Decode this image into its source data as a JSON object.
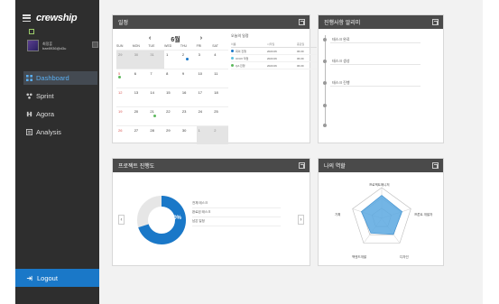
{
  "app": {
    "logo": "crewship"
  },
  "profile": {
    "name": "최정훈",
    "email": "bae8936@d3u"
  },
  "nav": [
    {
      "label": "Dashboard",
      "icon": "grid-icon",
      "active": true
    },
    {
      "label": "Sprint",
      "icon": "sprint-icon",
      "active": false
    },
    {
      "label": "Agora",
      "icon": "agora-icon",
      "active": false
    },
    {
      "label": "Analysis",
      "icon": "analysis-icon",
      "active": false
    }
  ],
  "logout_label": "Logout",
  "calendar": {
    "title": "일정",
    "month_label": "6월",
    "prev": "‹",
    "next": "›",
    "dow": [
      "SUN",
      "MON",
      "TUE",
      "WED",
      "THU",
      "FRI",
      "SAT"
    ],
    "weeks": [
      [
        "29",
        "30",
        "31",
        "1",
        "2",
        "3",
        "4"
      ],
      [
        "5",
        "6",
        "7",
        "8",
        "9",
        "10",
        "11"
      ],
      [
        "12",
        "13",
        "14",
        "15",
        "16",
        "17",
        "18"
      ],
      [
        "19",
        "20",
        "21",
        "22",
        "23",
        "24",
        "25"
      ],
      [
        "26",
        "27",
        "28",
        "29",
        "30",
        "1",
        "2"
      ]
    ],
    "schedule_title": "오늘의 일정",
    "schedule_head": [
      "이름",
      "시작일",
      "종료일"
    ],
    "schedule_rows": [
      {
        "name": "회의 진행",
        "start": "2023.06",
        "end": "06.09",
        "color": "#1a78c8"
      },
      {
        "name": "UI/UX 작업",
        "start": "2023.06",
        "end": "06.09",
        "color": "#5bc0de"
      },
      {
        "name": "QA 진행",
        "start": "2023.06",
        "end": "06.09",
        "color": "#5cb85c"
      }
    ]
  },
  "timeline": {
    "title": "진행사항 알리미",
    "items": [
      "태스크 완료",
      "태스크 생성",
      "태스크 진행"
    ]
  },
  "project": {
    "title": "프로젝트 진행도",
    "percent_label": "70%",
    "percent": 70,
    "legend": [
      "전체 태스크",
      "완료된 태스크",
      "남은 일정"
    ],
    "accent": "#1a78c8"
  },
  "role": {
    "title": "나의 역할",
    "axes": [
      "프로젝트매니저",
      "프론트 개발자",
      "디자인",
      "백엔드개발",
      "기획"
    ],
    "values": [
      0.75,
      0.7,
      0.65,
      0.6,
      0.7
    ],
    "fill": "#5aa8e0"
  }
}
